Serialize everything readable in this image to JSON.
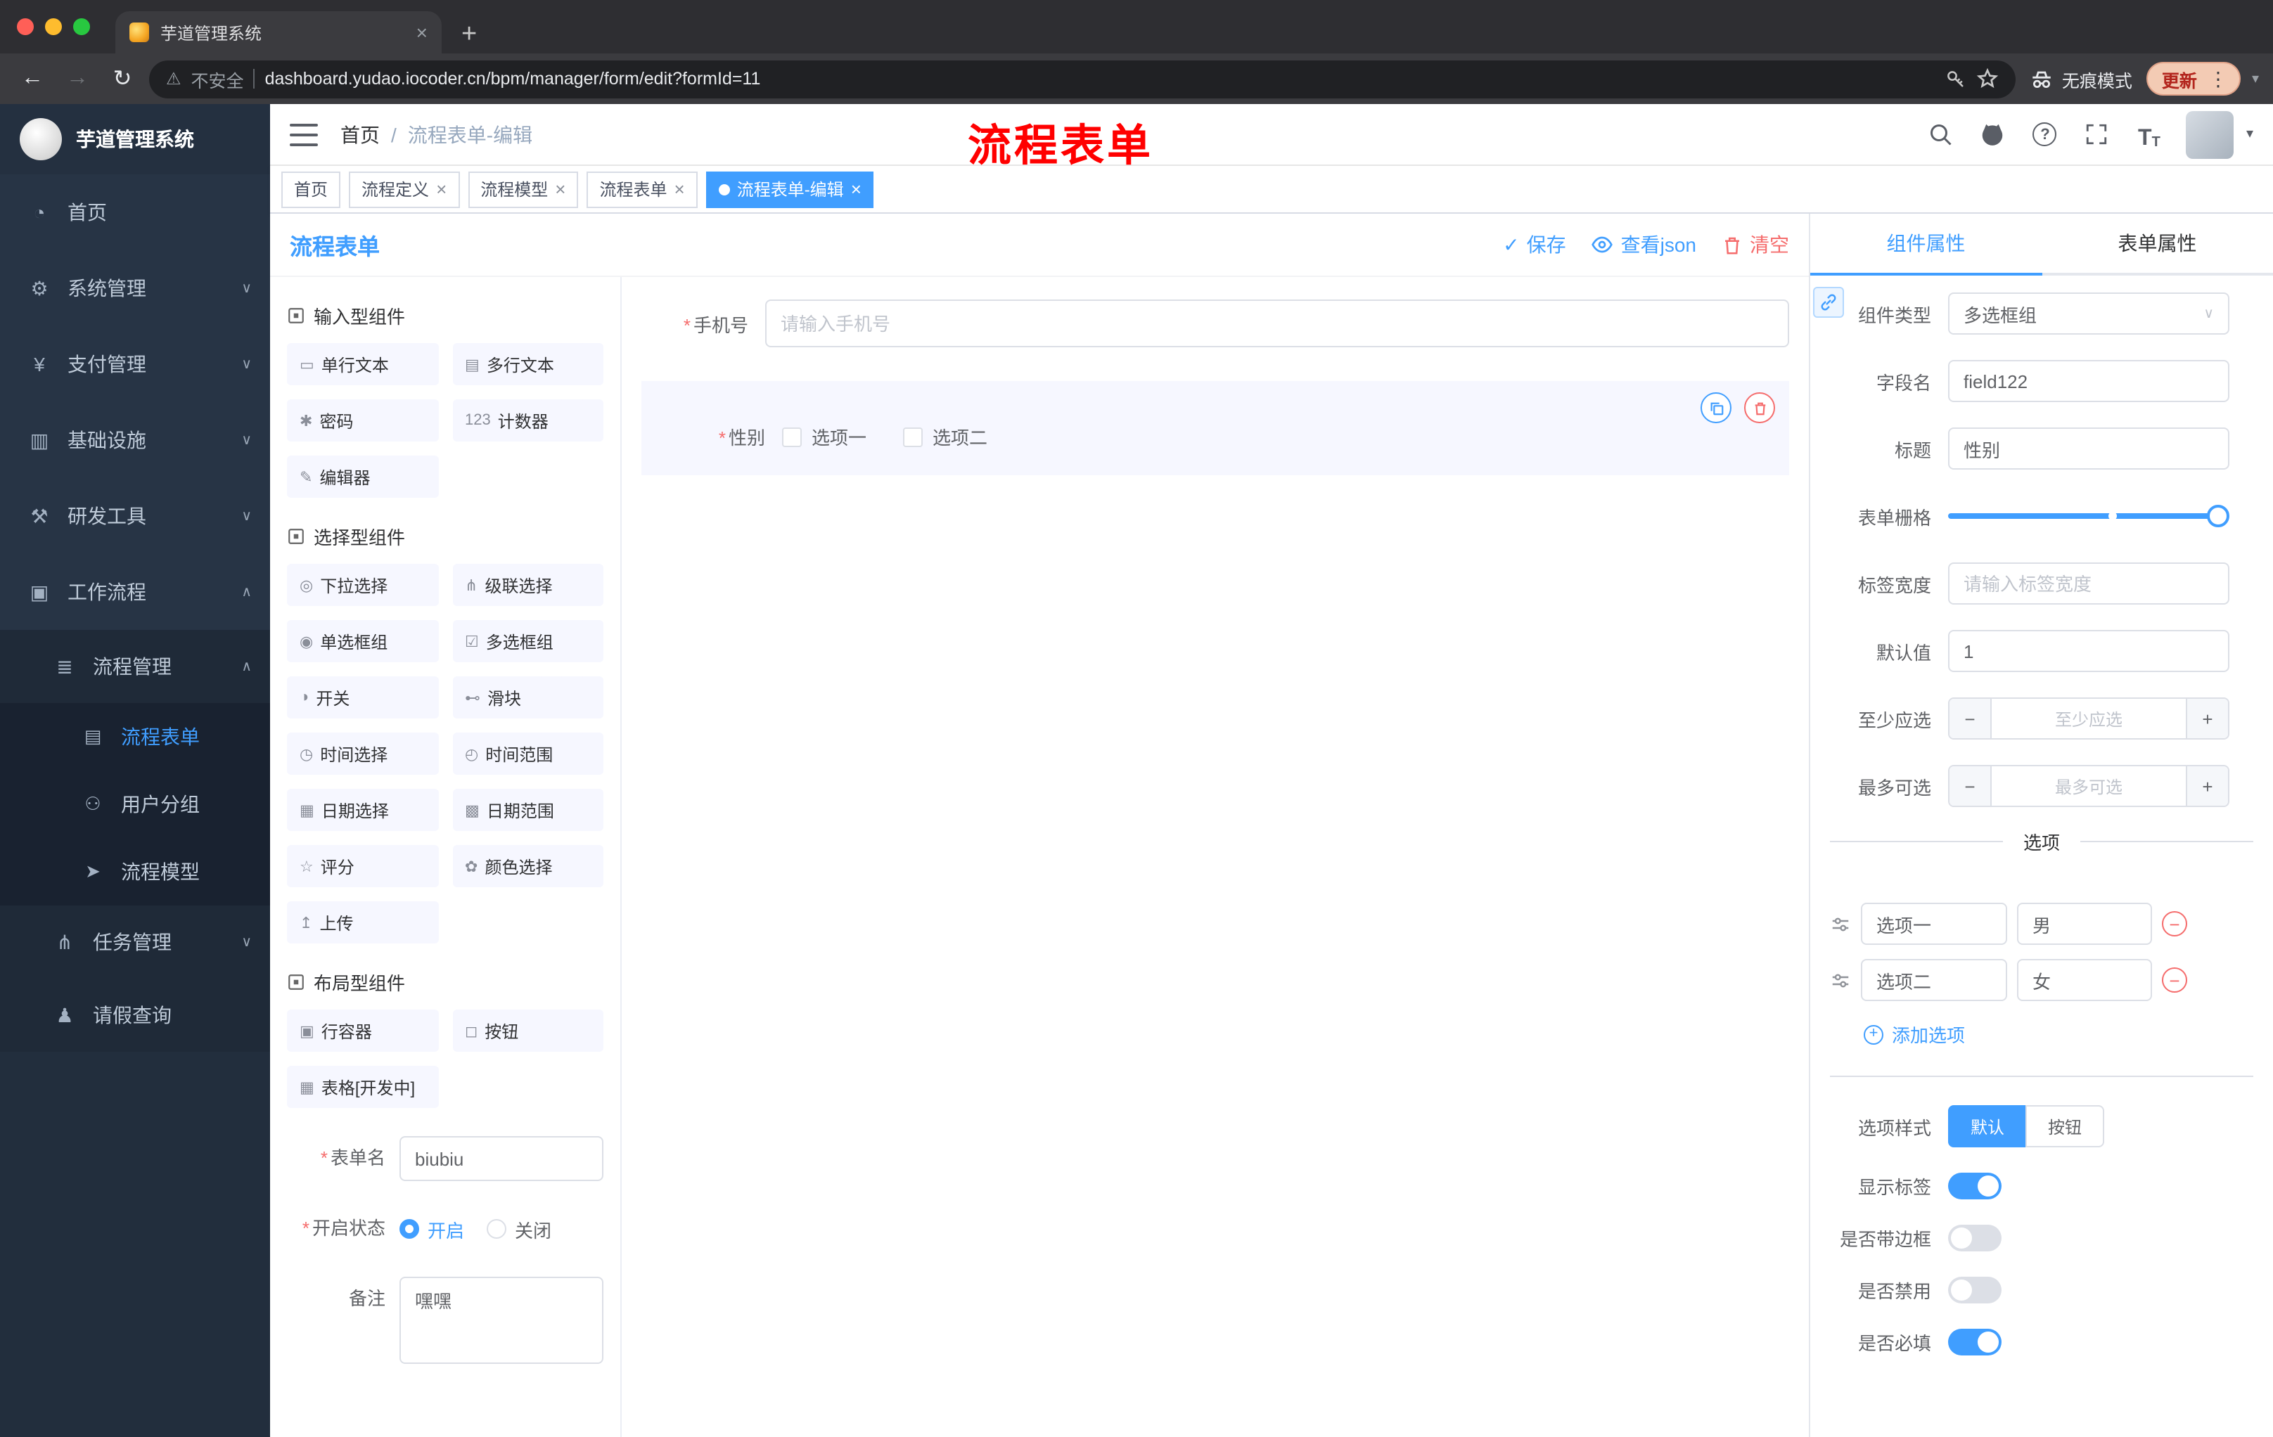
{
  "browser": {
    "tab_title": "芋道管理系统",
    "not_secure": "不安全",
    "url": "dashboard.yudao.iocoder.cn/bpm/manager/form/edit?formId=11",
    "incognito_label": "无痕模式",
    "update_label": "更新"
  },
  "icons": {
    "close": "×",
    "plus": "+",
    "back": "←",
    "forward": "→",
    "reload": "↻",
    "warning": "⚠",
    "kebab": "⋮",
    "caret_down": "▾",
    "chevron_down": "∨",
    "chevron_up": "∧",
    "check": "✓",
    "minus": "−",
    "question": "?",
    "t_large": "T",
    "t_small": "T"
  },
  "sidebar": {
    "logo_title": "芋道管理系统",
    "items": [
      {
        "icon": "◔",
        "label": "首页"
      },
      {
        "icon": "⚙",
        "label": "系统管理"
      },
      {
        "icon": "¥",
        "label": "支付管理"
      },
      {
        "icon": "▥",
        "label": "基础设施"
      },
      {
        "icon": "⚒",
        "label": "研发工具"
      },
      {
        "icon": "▣",
        "label": "工作流程"
      }
    ],
    "process_mgmt": {
      "icon": "≣",
      "label": "流程管理"
    },
    "process_children": [
      {
        "icon": "▤",
        "label": "流程表单"
      },
      {
        "icon": "⚇",
        "label": "用户分组"
      },
      {
        "icon": "➤",
        "label": "流程模型"
      }
    ],
    "task_mgmt": {
      "icon": "⋔",
      "label": "任务管理"
    },
    "leave_query": {
      "icon": "♟",
      "label": "请假查询"
    }
  },
  "header": {
    "breadcrumb": [
      "首页",
      "流程表单-编辑"
    ],
    "separator": "/",
    "annotation": "流程表单"
  },
  "tags": [
    {
      "label": "首页"
    },
    {
      "label": "流程定义"
    },
    {
      "label": "流程模型"
    },
    {
      "label": "流程表单"
    },
    {
      "label": "流程表单-编辑"
    }
  ],
  "designer": {
    "title": "流程表单",
    "actions": {
      "save": "保存",
      "view_json": "查看json",
      "clear": "清空"
    },
    "groups": [
      {
        "title": "输入型组件",
        "items": [
          {
            "icon": "▭",
            "label": "单行文本"
          },
          {
            "icon": "▤",
            "label": "多行文本"
          },
          {
            "icon": "✱",
            "label": "密码"
          },
          {
            "icon": "123",
            "label": "计数器"
          },
          {
            "icon": "✎",
            "label": "编辑器"
          }
        ]
      },
      {
        "title": "选择型组件",
        "items": [
          {
            "icon": "◎",
            "label": "下拉选择"
          },
          {
            "icon": "⋔",
            "label": "级联选择"
          },
          {
            "icon": "◉",
            "label": "单选框组"
          },
          {
            "icon": "☑",
            "label": "多选框组"
          },
          {
            "icon": "◑",
            "label": "开关"
          },
          {
            "icon": "⊷",
            "label": "滑块"
          },
          {
            "icon": "◷",
            "label": "时间选择"
          },
          {
            "icon": "◴",
            "label": "时间范围"
          },
          {
            "icon": "▦",
            "label": "日期选择"
          },
          {
            "icon": "▩",
            "label": "日期范围"
          },
          {
            "icon": "☆",
            "label": "评分"
          },
          {
            "icon": "✿",
            "label": "颜色选择"
          },
          {
            "icon": "↥",
            "label": "上传"
          }
        ]
      },
      {
        "title": "布局型组件",
        "items": [
          {
            "icon": "▣",
            "label": "行容器"
          },
          {
            "icon": "◻",
            "label": "按钮"
          },
          {
            "icon": "▦",
            "label": "表格[开发中]"
          }
        ]
      }
    ],
    "meta": {
      "name_label": "表单名",
      "name_value": "biubiu",
      "status_label": "开启状态",
      "status_on": "开启",
      "status_off": "关闭",
      "remark_label": "备注",
      "remark_value": "嘿嘿"
    },
    "canvas": {
      "phone_label": "手机号",
      "phone_placeholder": "请输入手机号",
      "gender_label": "性别",
      "gender_option1": "选项一",
      "gender_option2": "选项二"
    }
  },
  "props": {
    "tab_component": "组件属性",
    "tab_form": "表单属性",
    "component_type_label": "组件类型",
    "component_type_value": "多选框组",
    "field_name_label": "字段名",
    "field_name_value": "field122",
    "title_label": "标题",
    "title_value": "性别",
    "grid_label": "表单栅格",
    "label_width_label": "标签宽度",
    "label_width_placeholder": "请输入标签宽度",
    "default_label": "默认值",
    "default_value": "1",
    "min_label": "至少应选",
    "min_placeholder": "至少应选",
    "max_label": "最多可选",
    "max_placeholder": "最多可选",
    "options_title": "选项",
    "options": [
      {
        "label": "选项一",
        "value": "男"
      },
      {
        "label": "选项二",
        "value": "女"
      }
    ],
    "add_option": "添加选项",
    "option_style_label": "选项样式",
    "style_default": "默认",
    "style_button": "按钮",
    "toggles": [
      {
        "label": "显示标签",
        "on": true
      },
      {
        "label": "是否带边框",
        "on": false
      },
      {
        "label": "是否禁用",
        "on": false
      },
      {
        "label": "是否必填",
        "on": true
      }
    ]
  },
  "colors": {
    "accent": "#409eff",
    "danger": "#f56c6c",
    "annotation": "#ff0000",
    "sidebar_bg": "#273445",
    "active_tag_bg": "#409eff"
  }
}
